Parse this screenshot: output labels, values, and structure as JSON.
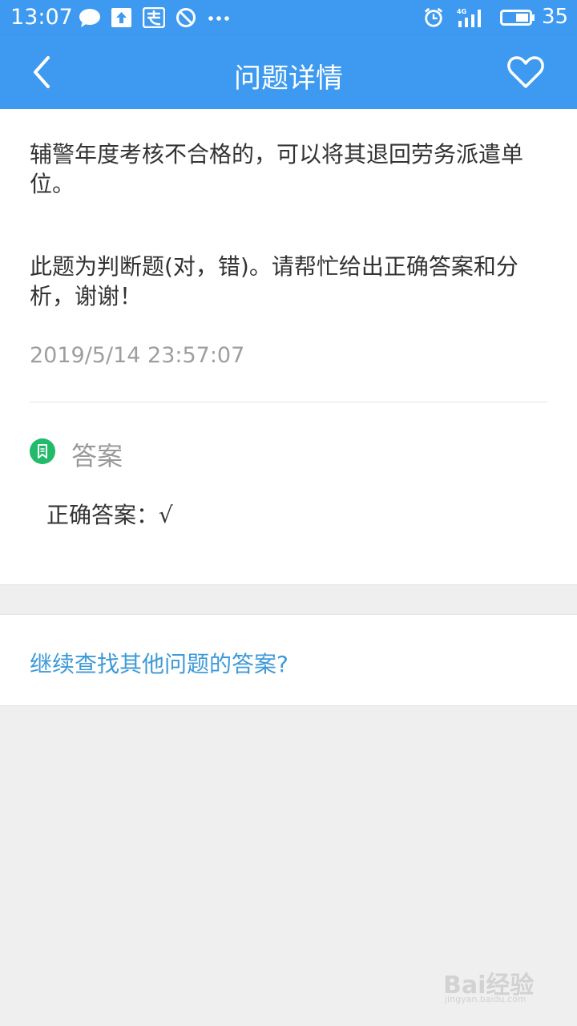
{
  "status_bar": {
    "time": "13:07",
    "network": "4G",
    "battery": "35",
    "icons": [
      "chat-icon",
      "upload-icon",
      "alipay-icon",
      "block-icon",
      "more-dots-icon",
      "alarm-icon",
      "signal-icon",
      "battery-icon"
    ]
  },
  "header": {
    "title": "问题详情",
    "back_icon": "chevron-left-icon",
    "favorite_icon": "heart-icon"
  },
  "question": {
    "text": "辅警年度考核不合格的，可以将其退回劳务派遣单位。",
    "note": "此题为判断题(对，错)。请帮忙给出正确答案和分析，谢谢！",
    "date": "2019/5/14 23:57:07"
  },
  "answer": {
    "heading": "答案",
    "text": "正确答案：√",
    "icon": "bookmark-icon",
    "icon_color": "#22bb6a"
  },
  "more_link": "继续查找其他问题的答案?",
  "watermark": {
    "main": "Bai经验",
    "sub": "jingyan.baidu.com"
  },
  "colors": {
    "accent": "#3d9af0",
    "link": "#3d9ad8",
    "background": "#efefef"
  }
}
